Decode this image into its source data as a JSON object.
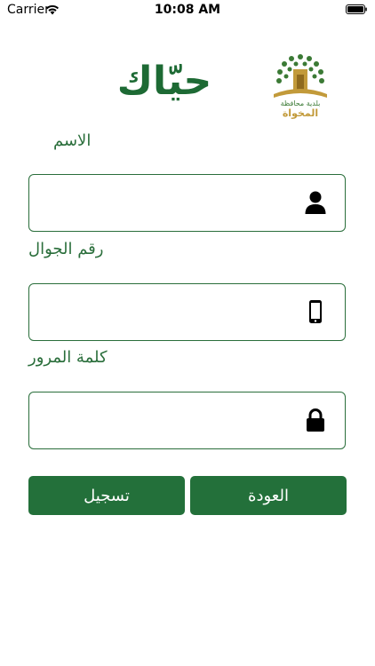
{
  "status_bar": {
    "carrier": "Carrier",
    "time": "10:08 AM"
  },
  "logo": {
    "brand_text": "حيّاك",
    "seal_text_top": "بلدية محافظة",
    "seal_text_bottom": "المخواة",
    "brand_color": "#1d6a34",
    "seal_color": "#c29a3a"
  },
  "form": {
    "name_label": "الاسم",
    "name_value": "",
    "phone_label": "رقم الجوال",
    "phone_value": "",
    "password_label": "كلمة المرور",
    "password_value": "",
    "name_icon": "user-icon",
    "phone_icon": "mobile-phone-icon",
    "password_icon": "lock-icon"
  },
  "buttons": {
    "register": "تسجيل",
    "back": "العودة"
  },
  "colors": {
    "primary": "#23703a",
    "label": "#2a6e3b"
  }
}
